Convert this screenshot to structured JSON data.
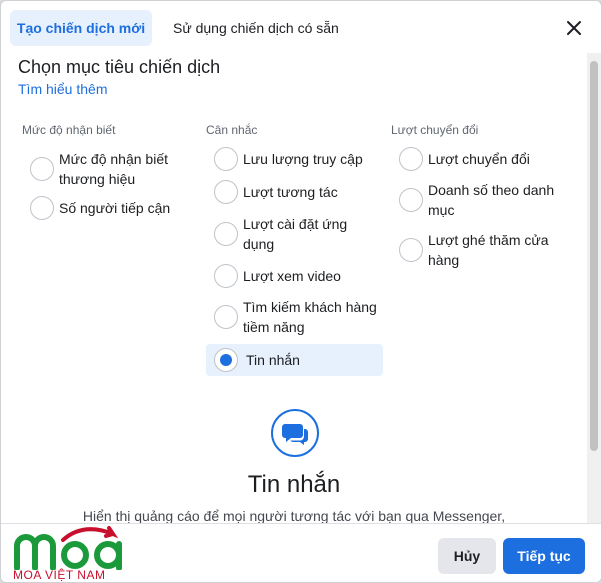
{
  "tabs": [
    {
      "label": "Tạo chiến dịch mới",
      "active": true
    },
    {
      "label": "Sử dụng chiến dịch có sẵn",
      "active": false
    }
  ],
  "heading": {
    "title": "Chọn mục tiêu chiến dịch",
    "learn_more": "Tìm hiểu thêm"
  },
  "columns": [
    {
      "title": "Mức độ nhận biết",
      "options": [
        {
          "label": "Mức độ nhận biết thương hiệu",
          "selected": false
        },
        {
          "label": "Số người tiếp cận",
          "selected": false
        }
      ]
    },
    {
      "title": "Cân nhắc",
      "options": [
        {
          "label": "Lưu lượng truy cập",
          "selected": false
        },
        {
          "label": "Lượt tương tác",
          "selected": false
        },
        {
          "label": "Lượt cài đặt ứng dụng",
          "selected": false
        },
        {
          "label": "Lượt xem video",
          "selected": false
        },
        {
          "label": "Tìm kiếm khách hàng tiềm năng",
          "selected": false
        },
        {
          "label": "Tin nhắn",
          "selected": true
        }
      ]
    },
    {
      "title": "Lượt chuyển đổi",
      "options": [
        {
          "label": "Lượt chuyển đổi",
          "selected": false
        },
        {
          "label": "Doanh số theo danh mục",
          "selected": false
        },
        {
          "label": "Lượt ghé thăm cửa hàng",
          "selected": false
        }
      ]
    }
  ],
  "detail": {
    "icon": "messenger-chat-icon",
    "title": "Tin nhắn",
    "description": "Hiển thị quảng cáo để mọi người tương tác với bạn qua Messenger,"
  },
  "footer": {
    "cancel_label": "Hủy",
    "next_label": "Tiếp tục"
  },
  "watermark": {
    "logo_text": "moa",
    "tagline": "MOA VIỆT NAM"
  },
  "colors": {
    "accent": "#1d6fe0",
    "tab_active_bg": "#e7f0fd",
    "logo_green": "#1a9a3a",
    "logo_red": "#c8102e"
  }
}
